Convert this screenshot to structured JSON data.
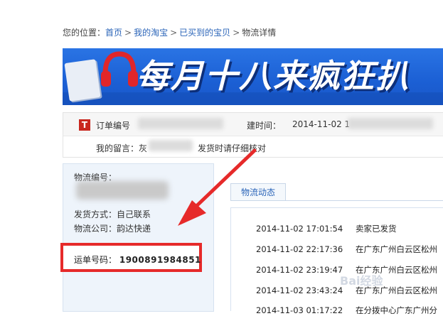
{
  "breadcrumb": {
    "prefix": "您的位置：",
    "home": "首页",
    "my_taobao": "我的淘宝",
    "bought": "已买到的宝贝",
    "current": "物流详情",
    "separator": ">"
  },
  "banner": {
    "slogan": "每月十八来疯狂扒",
    "colors": {
      "background": "#1b5fd4",
      "text": "#ffffff",
      "accent": "#ffcc00"
    }
  },
  "order": {
    "icon_letter": "T",
    "order_no_label": "订单编号",
    "created_label": "建时间：",
    "created_value": "2014-11-02 1",
    "message_label": "我的留言：",
    "message_prefix": "灰",
    "message_text": "发货时请仔细核对"
  },
  "logistics": {
    "no_label": "物流编号：",
    "ship_method_label": "发货方式：",
    "ship_method_value": "自己联系",
    "company_label": "物流公司：",
    "company_value": "韵达快递",
    "waybill_label": "运单号码：",
    "waybill_value": "1900891984851"
  },
  "tracking": {
    "tab_label": "物流动态",
    "events": [
      {
        "time": "2014-11-02 17:01:54",
        "desc": "卖家已发货"
      },
      {
        "time": "2014-11-02 22:17:36",
        "desc": "在广东广州白云区松州"
      },
      {
        "time": "2014-11-02 23:19:47",
        "desc": "在广东广州白云区松州"
      },
      {
        "time": "2014-11-02 23:43:24",
        "desc": "在广东广州白云区松州"
      },
      {
        "time": "2014-11-03 01:17:22",
        "desc": "在分拨中心广东广州分"
      }
    ]
  },
  "annotation": {
    "highlight_color": "#e62a2a"
  },
  "watermark": "Bai经验"
}
